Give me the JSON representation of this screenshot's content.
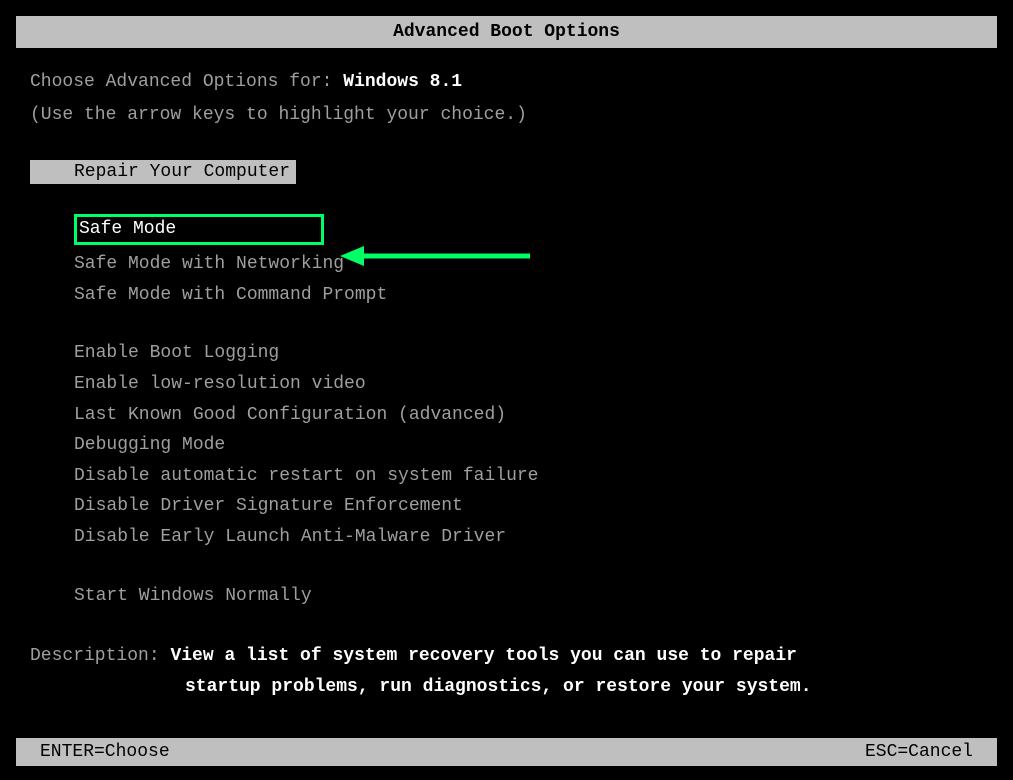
{
  "title": "Advanced Boot Options",
  "header": {
    "label": "Choose Advanced Options for: ",
    "os_name": "Windows 8.1",
    "hint": "(Use the arrow keys to highlight your choice.)"
  },
  "repair_label": "Repair Your Computer",
  "menu": {
    "group1": [
      "Safe Mode",
      "Safe Mode with Networking",
      "Safe Mode with Command Prompt"
    ],
    "group2": [
      "Enable Boot Logging",
      "Enable low-resolution video",
      "Last Known Good Configuration (advanced)",
      "Debugging Mode",
      "Disable automatic restart on system failure",
      "Disable Driver Signature Enforcement",
      "Disable Early Launch Anti-Malware Driver"
    ],
    "group3": [
      "Start Windows Normally"
    ]
  },
  "description": {
    "label": "Description: ",
    "line1": "View a list of system recovery tools you can use to repair",
    "line2": "startup problems, run diagnostics, or restore your system."
  },
  "footer": {
    "enter": "ENTER=Choose",
    "esc": "ESC=Cancel"
  }
}
